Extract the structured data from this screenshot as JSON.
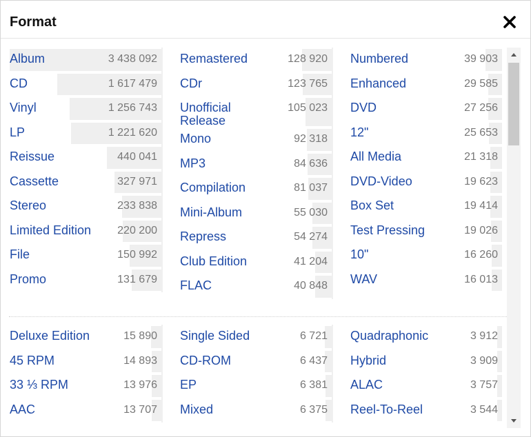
{
  "dialog": {
    "title": "Format",
    "close_icon": "close-icon"
  },
  "colors": {
    "link": "#1f4aa6",
    "count": "#777777",
    "bar": "#efefef"
  },
  "top": [
    [
      {
        "label": "Album",
        "count": "3 438 092",
        "v": 3438092
      },
      {
        "label": "CD",
        "count": "1 617 479",
        "v": 1617479
      },
      {
        "label": "Vinyl",
        "count": "1 256 743",
        "v": 1256743
      },
      {
        "label": "LP",
        "count": "1 221 620",
        "v": 1221620
      },
      {
        "label": "Reissue",
        "count": "440 041",
        "v": 440041
      },
      {
        "label": "Cassette",
        "count": "327 971",
        "v": 327971
      },
      {
        "label": "Stereo",
        "count": "233 838",
        "v": 233838
      },
      {
        "label": "Limited Edition",
        "count": "220 200",
        "v": 220200
      },
      {
        "label": "File",
        "count": "150 992",
        "v": 150992
      },
      {
        "label": "Promo",
        "count": "131 679",
        "v": 131679
      }
    ],
    [
      {
        "label": "Remastered",
        "count": "128 920",
        "v": 128920
      },
      {
        "label": "CDr",
        "count": "123 765",
        "v": 123765
      },
      {
        "label": "Unofficial Release",
        "count": "105 023",
        "v": 105023
      },
      {
        "label": "Mono",
        "count": "92 318",
        "v": 92318
      },
      {
        "label": "MP3",
        "count": "84 636",
        "v": 84636
      },
      {
        "label": "Compilation",
        "count": "81 037",
        "v": 81037
      },
      {
        "label": "Mini-Album",
        "count": "55 030",
        "v": 55030
      },
      {
        "label": "Repress",
        "count": "54 274",
        "v": 54274
      },
      {
        "label": "Club Edition",
        "count": "41 204",
        "v": 41204
      },
      {
        "label": "FLAC",
        "count": "40 848",
        "v": 40848
      }
    ],
    [
      {
        "label": "Numbered",
        "count": "39 903",
        "v": 39903
      },
      {
        "label": "Enhanced",
        "count": "29 585",
        "v": 29585
      },
      {
        "label": "DVD",
        "count": "27 256",
        "v": 27256
      },
      {
        "label": "12\"",
        "count": "25 653",
        "v": 25653
      },
      {
        "label": "All Media",
        "count": "21 318",
        "v": 21318
      },
      {
        "label": "DVD-Video",
        "count": "19 623",
        "v": 19623
      },
      {
        "label": "Box Set",
        "count": "19 414",
        "v": 19414
      },
      {
        "label": "Test Pressing",
        "count": "19 026",
        "v": 19026
      },
      {
        "label": "10\"",
        "count": "16 260",
        "v": 16260
      },
      {
        "label": "WAV",
        "count": "16 013",
        "v": 16013
      }
    ]
  ],
  "bottom": [
    [
      {
        "label": "Deluxe Edition",
        "count": "15 890",
        "v": 15890
      },
      {
        "label": "45 RPM",
        "count": "14 893",
        "v": 14893
      },
      {
        "label": "33 ⅓ RPM",
        "count": "13 976",
        "v": 13976
      },
      {
        "label": "AAC",
        "count": "13 707",
        "v": 13707
      }
    ],
    [
      {
        "label": "Single Sided",
        "count": "6 721",
        "v": 6721
      },
      {
        "label": "CD-ROM",
        "count": "6 437",
        "v": 6437
      },
      {
        "label": "EP",
        "count": "6 381",
        "v": 6381
      },
      {
        "label": "Mixed",
        "count": "6 375",
        "v": 6375
      }
    ],
    [
      {
        "label": "Quadraphonic",
        "count": "3 912",
        "v": 3912
      },
      {
        "label": "Hybrid",
        "count": "3 909",
        "v": 3909
      },
      {
        "label": "ALAC",
        "count": "3 757",
        "v": 3757
      },
      {
        "label": "Reel-To-Reel",
        "count": "3 544",
        "v": 3544
      }
    ]
  ]
}
